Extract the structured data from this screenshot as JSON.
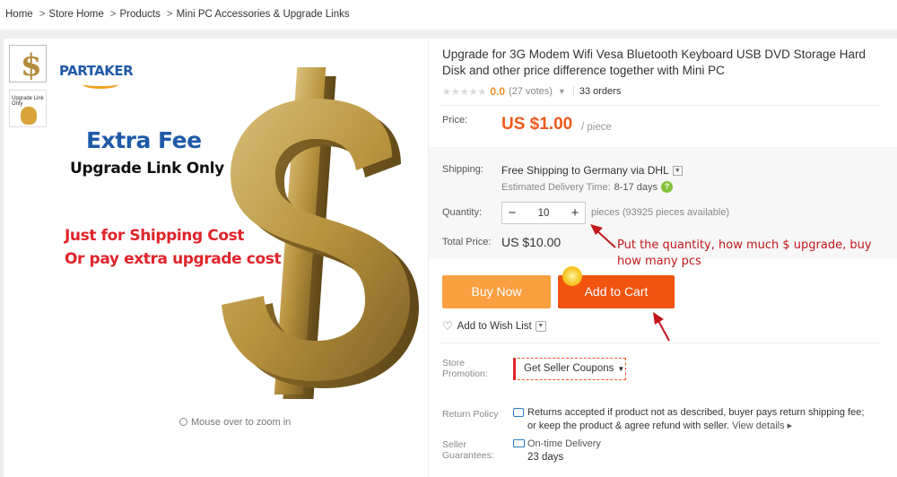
{
  "breadcrumb": {
    "items": [
      "Home",
      "Store Home",
      "Products",
      "Mini PC Accessories & Upgrade Links"
    ],
    "separator": ">"
  },
  "gallery": {
    "thumb2_text": "Upgrade Link Only",
    "logo_text": "PARTAKER",
    "headline": "Extra Fee",
    "subheadline": "Upgrade Link Only",
    "red_line1": "Just for Shipping Cost",
    "red_line2": "Or pay extra upgrade cost",
    "zoom_hint": "Mouse over to zoom in",
    "icon": "magnifier-icon"
  },
  "product": {
    "title": "Upgrade for 3G Modem Wifi Vesa Bluetooth Keyboard USB DVD Storage Hard Disk and other price difference together with Mini PC",
    "rating": {
      "stars": "★★★★★",
      "score": "0.0",
      "votes": "(27 votes)",
      "orders": "33 orders"
    },
    "price": {
      "label": "Price:",
      "value": "US $1.00",
      "unit": "/ piece"
    },
    "shipping": {
      "label": "Shipping:",
      "value": "Free Shipping to Germany via DHL",
      "estimate_label": "Estimated Delivery Time:",
      "estimate_value": "8-17 days"
    },
    "quantity": {
      "label": "Quantity:",
      "value": "10",
      "minus": "−",
      "plus": "+",
      "available": "pieces (93925 pieces available)"
    },
    "total": {
      "label": "Total Price:",
      "value": "US $10.00"
    }
  },
  "annotation": {
    "text": "Put the quantity, how much $ upgrade, buy how many pcs",
    "color": "#c0171c"
  },
  "actions": {
    "buy_now": "Buy Now",
    "add_to_cart": "Add to Cart",
    "wish_list": "Add to Wish List",
    "buy_color": "#fba041",
    "cart_color": "#f2530f"
  },
  "store": {
    "promotion_label": "Store Promotion:",
    "coupon_button": "Get Seller Coupons",
    "return_label": "Return Policy",
    "return_line1": "Returns accepted if product not as described, buyer pays return shipping fee;",
    "return_line2": "or keep the product & agree refund with seller.",
    "view_details": "View details ▸",
    "guarantee_label": "Seller Guarantees:",
    "guarantee_value": "On-time Delivery",
    "guarantee_days": "23 days"
  }
}
